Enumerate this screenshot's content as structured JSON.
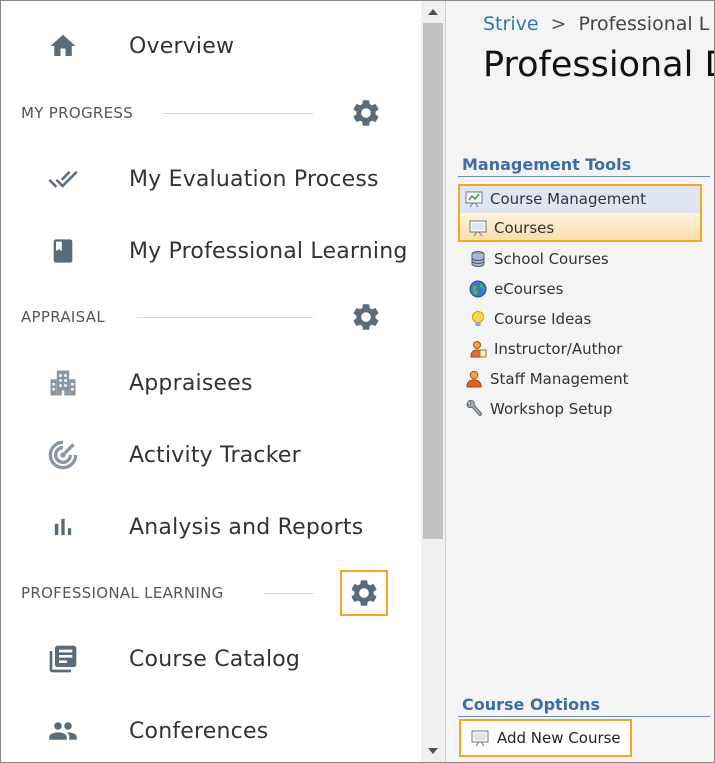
{
  "nav": {
    "overview": "Overview",
    "sections": {
      "progress": "MY PROGRESS",
      "appraisal": "APPRAISAL",
      "professional_learning": "PROFESSIONAL LEARNING"
    },
    "items": {
      "evaluation": "My Evaluation Process",
      "prof_learning": "My Professional Learning",
      "appraisees": "Appraisees",
      "activity": "Activity Tracker",
      "analysis": "Analysis and Reports",
      "catalog": "Course Catalog",
      "conferences": "Conferences"
    },
    "icons": {
      "overview": "home-icon",
      "evaluation": "double-check-icon",
      "prof_learning": "book-icon",
      "appraisees": "building-icon",
      "activity": "radar-icon",
      "analysis": "bar-chart-icon",
      "catalog": "library-books-icon",
      "conferences": "people-icon",
      "gear": "gear-icon"
    }
  },
  "header": {
    "breadcrumb_root": "Strive",
    "breadcrumb_sep": ">",
    "breadcrumb_current": "Professional L",
    "title": "Professional D"
  },
  "management_tools": {
    "title": "Management Tools",
    "items": [
      "Course Management",
      "Courses",
      "School Courses",
      "eCourses",
      "Course Ideas",
      "Instructor/Author",
      "Staff Management",
      "Workshop Setup"
    ]
  },
  "course_options": {
    "title": "Course Options",
    "add_new": "Add New Course"
  },
  "colors": {
    "highlight": "#f5a623",
    "link": "#2a7ab0",
    "section_title": "#3a6ea5",
    "icon_gray": "#5b6b78"
  }
}
